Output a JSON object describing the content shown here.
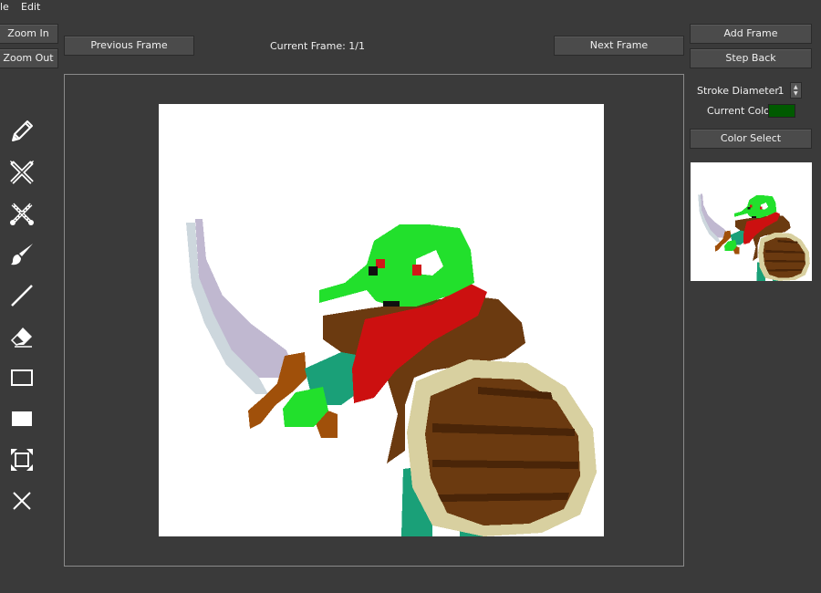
{
  "menu": {
    "file_label": "le",
    "edit_label": "Edit"
  },
  "buttons": {
    "zoom_in": "Zoom In",
    "zoom_out": "Zoom Out",
    "previous_frame": "Previous Frame",
    "next_frame": "Next Frame",
    "add_frame": "Add Frame",
    "step_back": "Step Back",
    "color_select": "Color Select"
  },
  "frame": {
    "label": "Current Frame: 1/1"
  },
  "stroke": {
    "label": "Stroke Diameter",
    "value": "1"
  },
  "current_color": {
    "label": "Current Color",
    "color": "#005a00"
  },
  "tools": [
    "pencil-icon",
    "crossed-pencils-icon",
    "crossed-brushes-icon",
    "brush-icon",
    "line-icon",
    "eraser-icon",
    "rectangle-outline-icon",
    "filled-rectangle-icon",
    "fit-screen-icon",
    "clear-icon"
  ],
  "palette": {
    "green": "#22e02c",
    "red": "#cc1010",
    "brown": "#6b3a10",
    "dark_brown": "#4a2508",
    "teal": "#1aa078",
    "blade": "#c0b8d0",
    "tan": "#d8d0a0"
  }
}
